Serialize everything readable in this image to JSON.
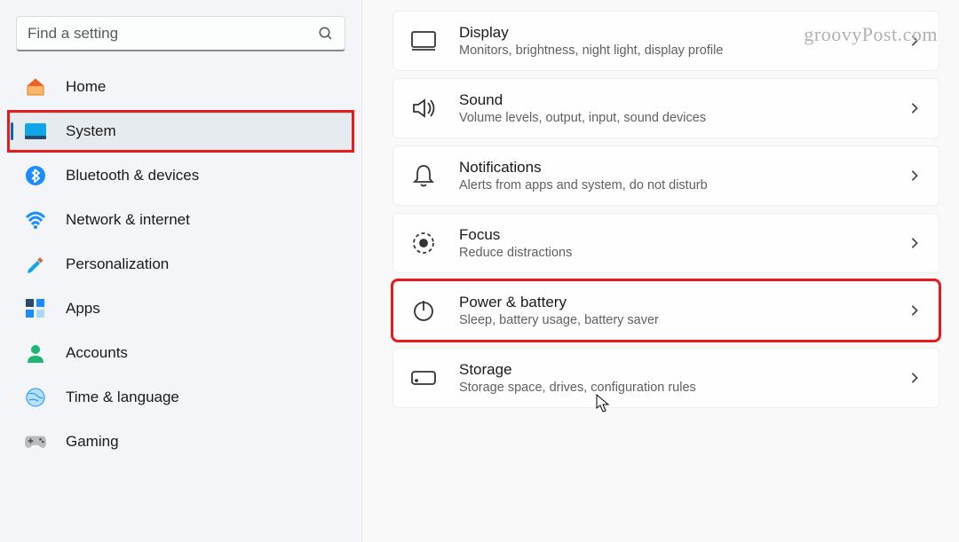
{
  "search": {
    "placeholder": "Find a setting"
  },
  "watermark": "groovyPost.com",
  "sidebar": {
    "items": [
      {
        "label": "Home"
      },
      {
        "label": "System"
      },
      {
        "label": "Bluetooth & devices"
      },
      {
        "label": "Network & internet"
      },
      {
        "label": "Personalization"
      },
      {
        "label": "Apps"
      },
      {
        "label": "Accounts"
      },
      {
        "label": "Time & language"
      },
      {
        "label": "Gaming"
      }
    ]
  },
  "cards": [
    {
      "title": "Display",
      "desc": "Monitors, brightness, night light, display profile"
    },
    {
      "title": "Sound",
      "desc": "Volume levels, output, input, sound devices"
    },
    {
      "title": "Notifications",
      "desc": "Alerts from apps and system, do not disturb"
    },
    {
      "title": "Focus",
      "desc": "Reduce distractions"
    },
    {
      "title": "Power & battery",
      "desc": "Sleep, battery usage, battery saver"
    },
    {
      "title": "Storage",
      "desc": "Storage space, drives, configuration rules"
    }
  ]
}
